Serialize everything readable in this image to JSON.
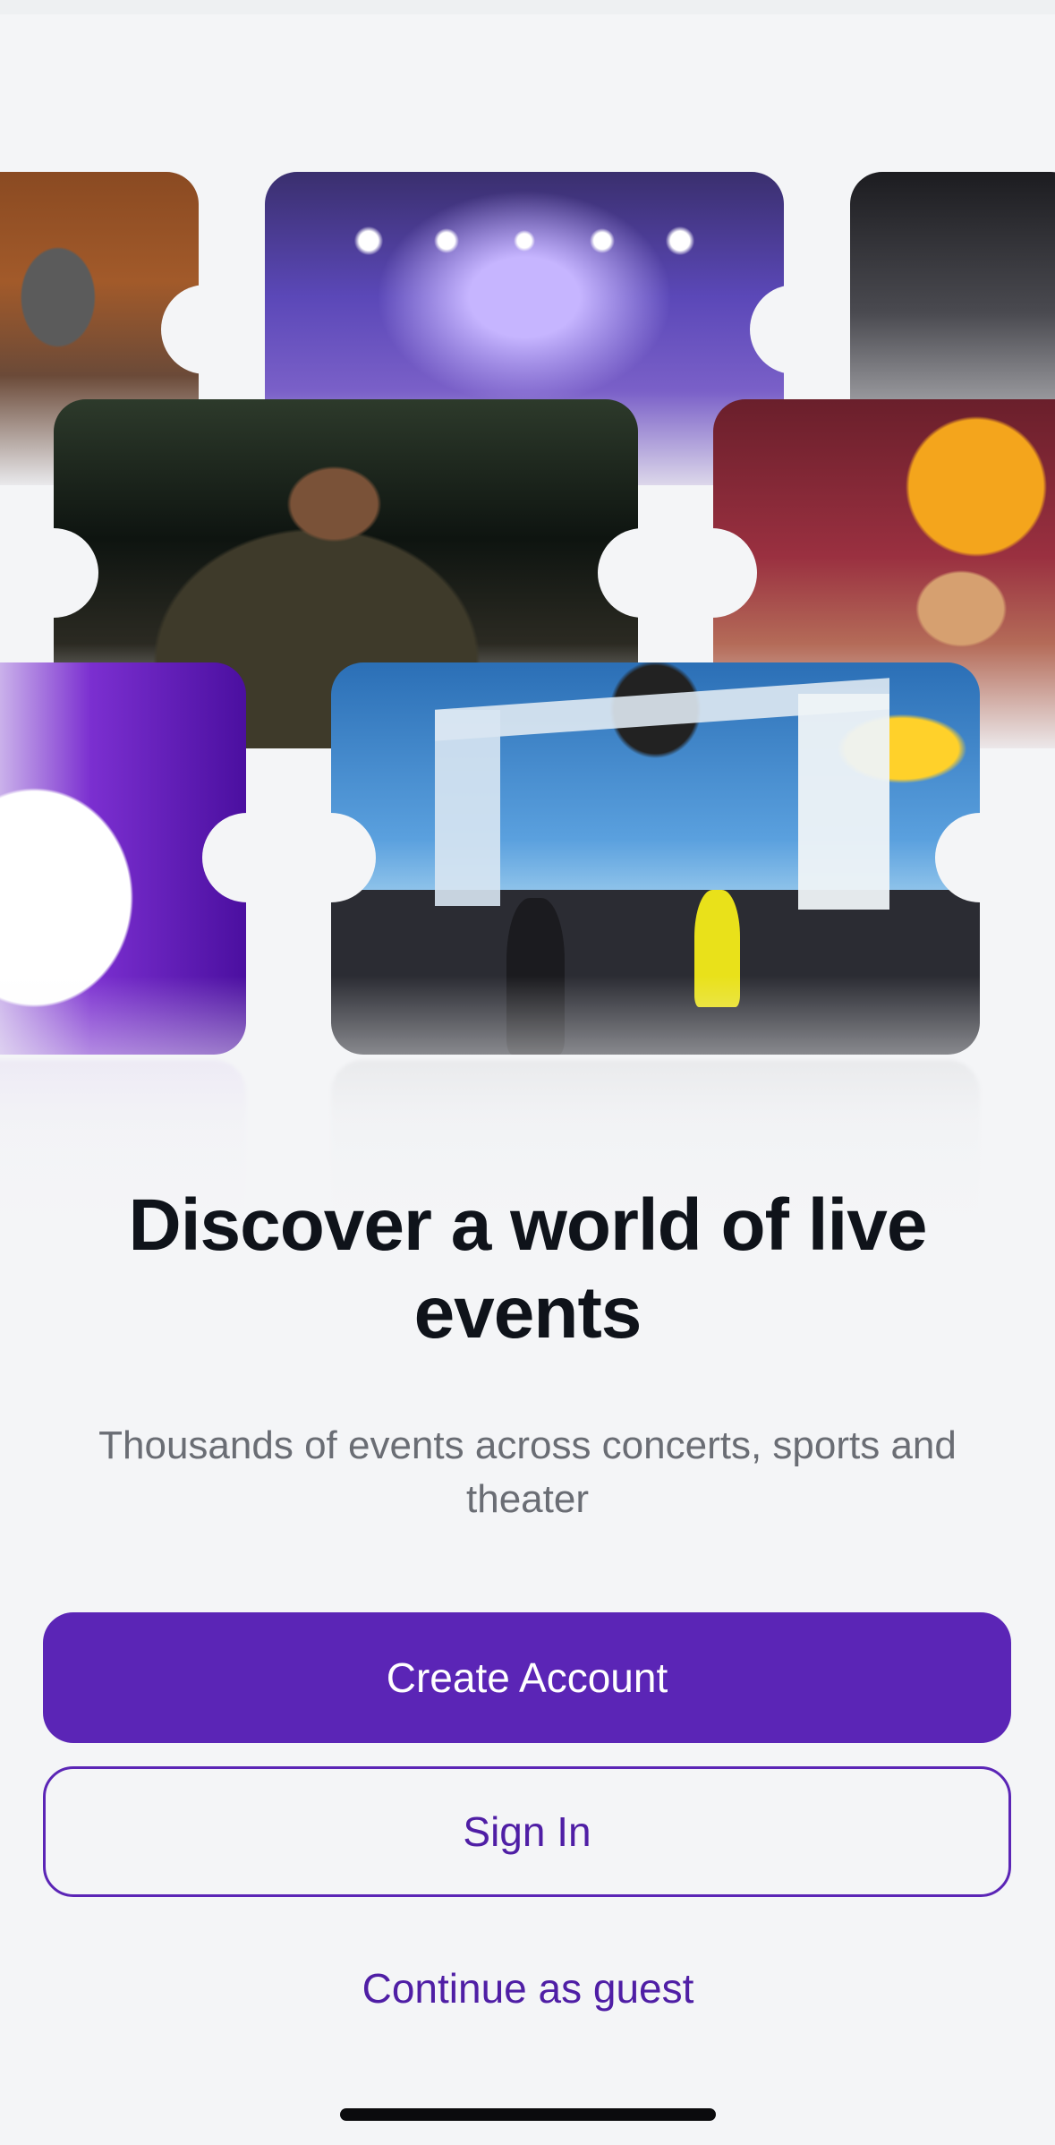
{
  "onboarding": {
    "title": "Discover a world of live events",
    "subtitle": "Thousands of events across concerts, sports and theater",
    "create_account_label": "Create Account",
    "sign_in_label": "Sign In",
    "continue_guest_label": "Continue as guest"
  },
  "collage": {
    "tickets": [
      {
        "name": "ticket-orchestra",
        "icon": "orchestra-photo"
      },
      {
        "name": "ticket-concert-stage",
        "icon": "stage-photo"
      },
      {
        "name": "ticket-artist-right",
        "icon": "artist-photo"
      },
      {
        "name": "ticket-rapper",
        "icon": "rapper-photo"
      },
      {
        "name": "ticket-singer",
        "icon": "singer-photo"
      },
      {
        "name": "ticket-purple-artist",
        "icon": "artist-photo"
      },
      {
        "name": "ticket-festival",
        "icon": "festival-photo"
      }
    ]
  },
  "colors": {
    "accent": "#5b25b6",
    "background": "#f4f5f7",
    "title": "#0f131a",
    "subtitle": "#6a6d74"
  }
}
